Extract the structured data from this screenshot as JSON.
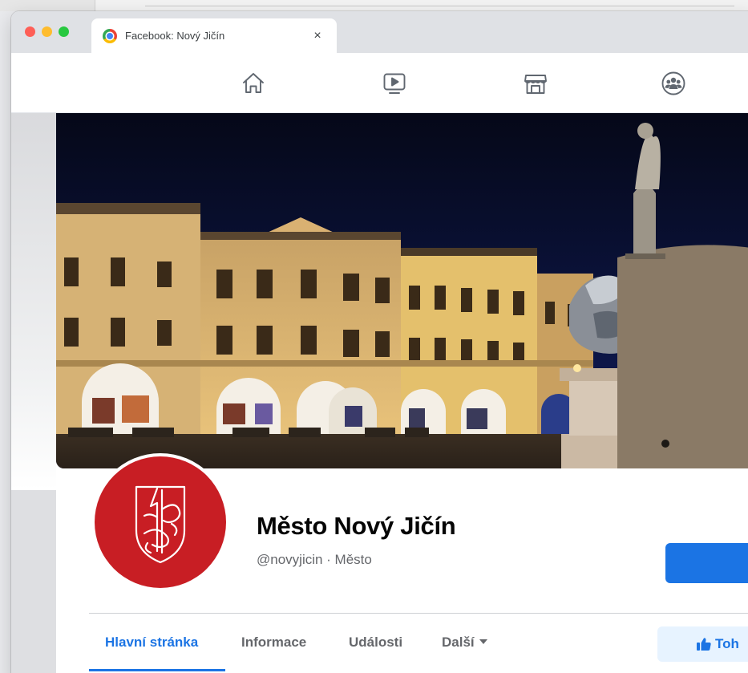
{
  "browser": {
    "tab_title": "Facebook: Nový Jičín",
    "close_glyph": "×",
    "favicon": "chrome-icon"
  },
  "fb_nav": {
    "icons": [
      "home-icon",
      "watch-icon",
      "marketplace-icon",
      "groups-icon"
    ]
  },
  "profile": {
    "name": "Město Nový Jičín",
    "handle": "@novyjicin · Město"
  },
  "tabs": {
    "items": [
      "Hlavní stránka",
      "Informace",
      "Události",
      "Další"
    ],
    "active": "Hlavní stránka"
  },
  "actions": {
    "like_label": "Toh"
  },
  "colors": {
    "accent": "#1b74e4",
    "avatar_red": "#c81e24",
    "like_bg": "#e7f3ff"
  }
}
